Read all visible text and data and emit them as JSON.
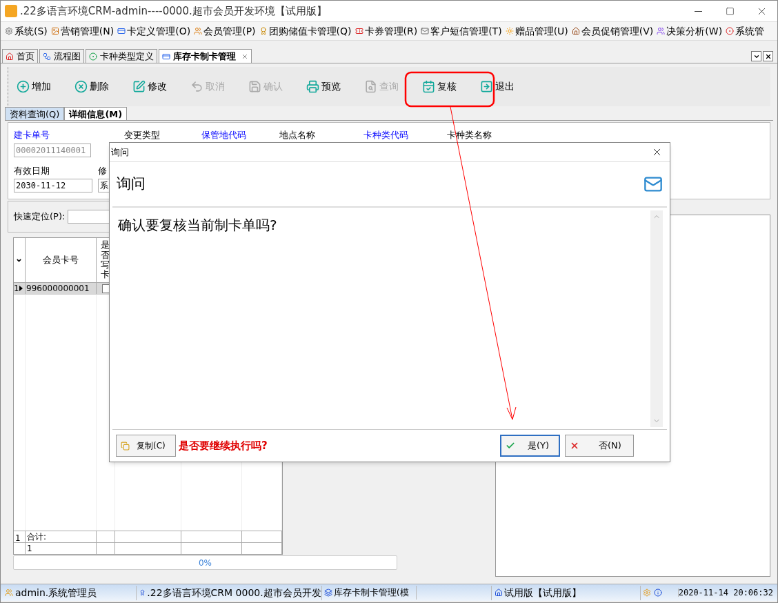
{
  "window": {
    "title": ".22多语言环境CRM-admin----0000.超市会员开发环境【试用版】"
  },
  "menu": [
    {
      "label": "系统(S)"
    },
    {
      "label": "营销管理(N)"
    },
    {
      "label": "卡定义管理(O)"
    },
    {
      "label": "会员管理(P)"
    },
    {
      "label": "团购储值卡管理(Q)"
    },
    {
      "label": "卡券管理(R)"
    },
    {
      "label": "客户短信管理(T)"
    },
    {
      "label": "赠品管理(U)"
    },
    {
      "label": "会员促销管理(V)"
    },
    {
      "label": "决策分析(W)"
    },
    {
      "label": "系统管"
    }
  ],
  "tabs": [
    {
      "label": "首页",
      "selected": false
    },
    {
      "label": "流程图",
      "selected": false
    },
    {
      "label": "卡种类型定义",
      "selected": false
    },
    {
      "label": "库存卡制卡管理",
      "selected": true
    }
  ],
  "toolbar": [
    {
      "label": "增加",
      "disabled": false
    },
    {
      "label": "删除",
      "disabled": false
    },
    {
      "label": "修改",
      "disabled": false
    },
    {
      "label": "取消",
      "disabled": true
    },
    {
      "label": "确认",
      "disabled": true
    },
    {
      "label": "预览",
      "disabled": false
    },
    {
      "label": "查询",
      "disabled": true
    },
    {
      "label": "复核",
      "disabled": false
    },
    {
      "label": "退出",
      "disabled": false
    }
  ],
  "subtabs": [
    {
      "label": "资料查询(Q)",
      "selected": false
    },
    {
      "label": "详细信息(M)",
      "selected": true
    }
  ],
  "form": {
    "rows": [
      {
        "fields": [
          {
            "label": "建卡单号",
            "highlighted": true,
            "value": "00002011140001",
            "disabled": true
          },
          {
            "label": "变更类型",
            "highlighted": false
          },
          {
            "label": "保管地代码",
            "highlighted": true
          },
          {
            "label": "地点名称",
            "highlighted": false
          },
          {
            "label": "卡种类代码",
            "highlighted": true
          },
          {
            "label": "卡种类名称",
            "highlighted": false
          }
        ]
      },
      {
        "fields": [
          {
            "label": "有效日期",
            "highlighted": false,
            "value": "2030-11-12",
            "disabled": false
          },
          {
            "label": "修",
            "highlighted": false,
            "value": "系",
            "disabled": false
          }
        ]
      }
    ]
  },
  "quick_locate": {
    "label": "快速定位(P):"
  },
  "grid": {
    "columns": [
      {
        "label": "会员卡号"
      },
      {
        "label": "是否写卡"
      }
    ],
    "rows": [
      {
        "index": "1",
        "selected": true,
        "card_no": "996000000001",
        "written": false
      }
    ],
    "footer": [
      {
        "index": "1",
        "label": "合计:"
      },
      {
        "label": "1"
      }
    ]
  },
  "progress": {
    "label": "0%",
    "level": 0
  },
  "dialog": {
    "title": "询问",
    "heading": "询问",
    "message": "确认要复核当前制卡单吗?",
    "copy_button": "复制(C)",
    "prompt": "是否要继续执行吗?",
    "buttons": [
      {
        "label": "是(Y)",
        "kind": "yes",
        "focused": true
      },
      {
        "label": "否(N)",
        "kind": "no",
        "focused": false
      }
    ]
  },
  "status_bar": {
    "user": "admin.系统管理员",
    "app": ".22多语言环境CRM 0000.超市会员开发",
    "module": "库存卡制卡管理(模",
    "edition": "试用版【试用版】",
    "time": "2020-11-14 20:06:32"
  }
}
